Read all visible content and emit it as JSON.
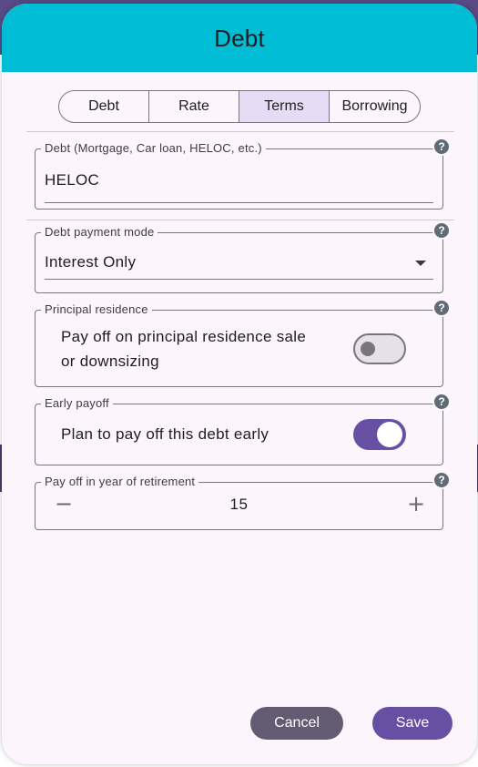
{
  "dialog": {
    "title": "Debt"
  },
  "tabs": [
    {
      "label": "Debt",
      "active": false
    },
    {
      "label": "Rate",
      "active": false
    },
    {
      "label": "Terms",
      "active": true
    },
    {
      "label": "Borrowing",
      "active": false
    }
  ],
  "debt_field": {
    "legend": "Debt (Mortgage, Car loan, HELOC, etc.)",
    "value": "HELOC",
    "help": "?"
  },
  "payment_mode": {
    "legend": "Debt payment mode",
    "value": "Interest Only",
    "help": "?"
  },
  "principal_residence": {
    "legend": "Principal residence",
    "label_line1": "Pay off on principal residence sale",
    "label_line2": "or downsizing",
    "checked": false,
    "help": "?"
  },
  "early_payoff": {
    "legend": "Early payoff",
    "label": "Plan to pay off this debt early",
    "checked": true,
    "help": "?"
  },
  "payoff_year": {
    "legend": "Pay off in year of retirement",
    "value": "15",
    "decrement_glyph": "−",
    "increment_glyph": "+",
    "help": "?"
  },
  "actions": {
    "cancel_label": "Cancel",
    "save_label": "Save"
  },
  "colors": {
    "header": "#00bcd4",
    "dialog_bg": "#fcf5fc",
    "primary": "#6750a4",
    "secondary": "#625b71",
    "tab_active": "#e6dcf6"
  }
}
